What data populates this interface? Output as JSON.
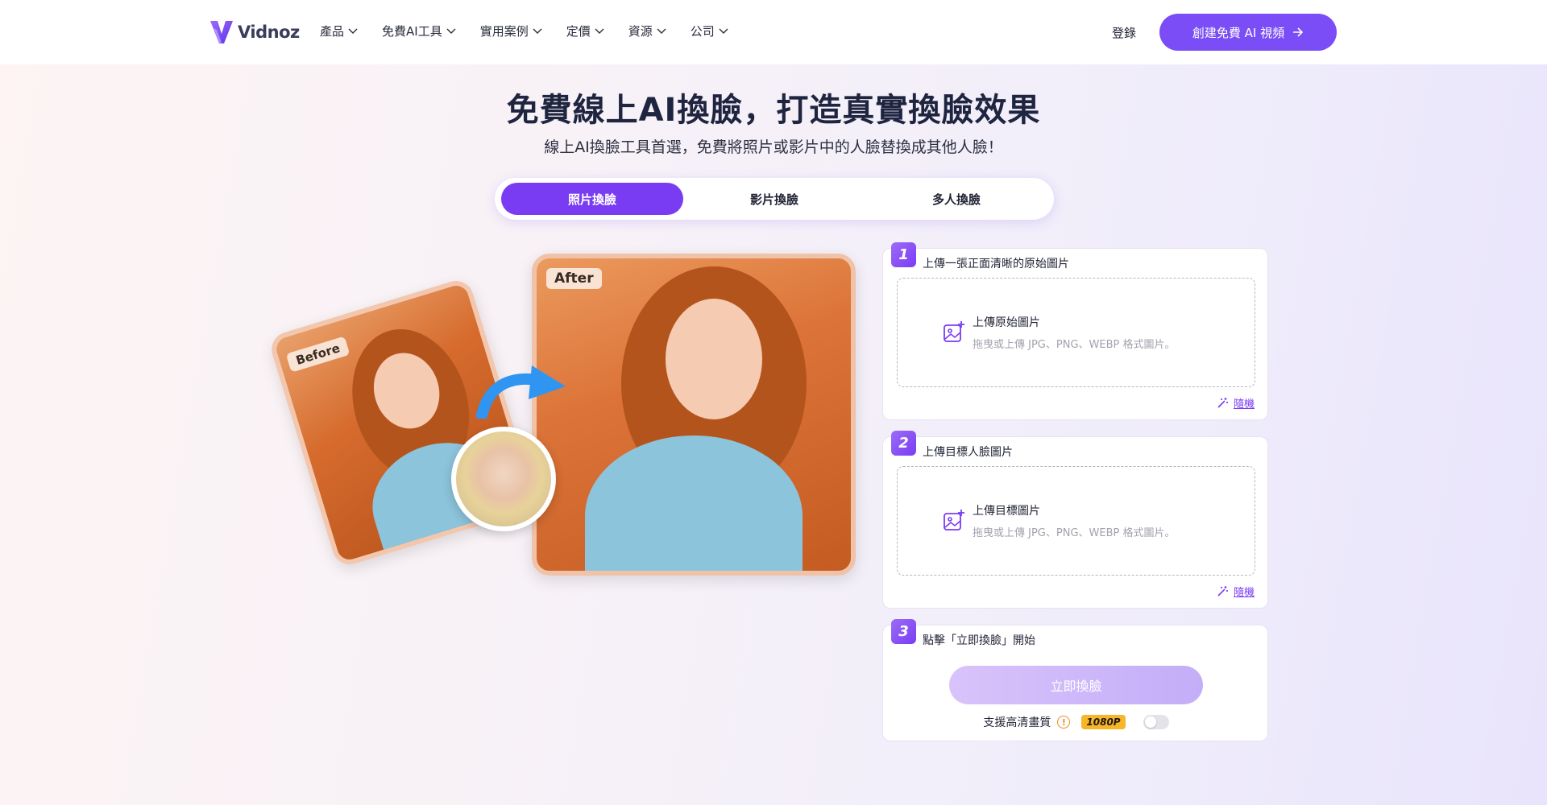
{
  "nav": {
    "logo_text": "Vidnoz",
    "menu": [
      {
        "label": "產品"
      },
      {
        "label": "免費AI工具"
      },
      {
        "label": "實用案例"
      },
      {
        "label": "定價"
      },
      {
        "label": "資源"
      },
      {
        "label": "公司"
      }
    ],
    "login": "登錄",
    "cta": "創建免費 AI 視頻"
  },
  "hero": {
    "title": "免費線上AI換臉，打造真實換臉效果",
    "subtitle": "線上AI換臉工具首選，免費將照片或影片中的人臉替換成其他人臉！"
  },
  "tabs": [
    {
      "label": "照片換臉",
      "active": true
    },
    {
      "label": "影片換臉",
      "active": false
    },
    {
      "label": "多人換臉",
      "active": false
    }
  ],
  "illustration": {
    "before_label": "Before",
    "after_label": "After"
  },
  "steps": {
    "step1": {
      "num": "1",
      "title": "上傳一張正面清晰的原始圖片",
      "upload_title": "上傳原始圖片",
      "upload_hint": "拖曳或上傳 JPG、PNG、WEBP 格式圖片。",
      "random": "隨機"
    },
    "step2": {
      "num": "2",
      "title": "上傳目標人臉圖片",
      "upload_title": "上傳目標圖片",
      "upload_hint": "拖曳或上傳 JPG、PNG、WEBP 格式圖片。",
      "random": "隨機"
    },
    "step3": {
      "num": "3",
      "title": "點擊「立即換臉」開始",
      "button": "立即換臉",
      "hd_label": "支援高清畫質",
      "hd_info": "!",
      "hd_badge": "1080P",
      "hd_toggle_on": false
    }
  },
  "colors": {
    "accent": "#7a3cf3",
    "cta": "#7a4df6",
    "badge": "#f7b52a"
  }
}
